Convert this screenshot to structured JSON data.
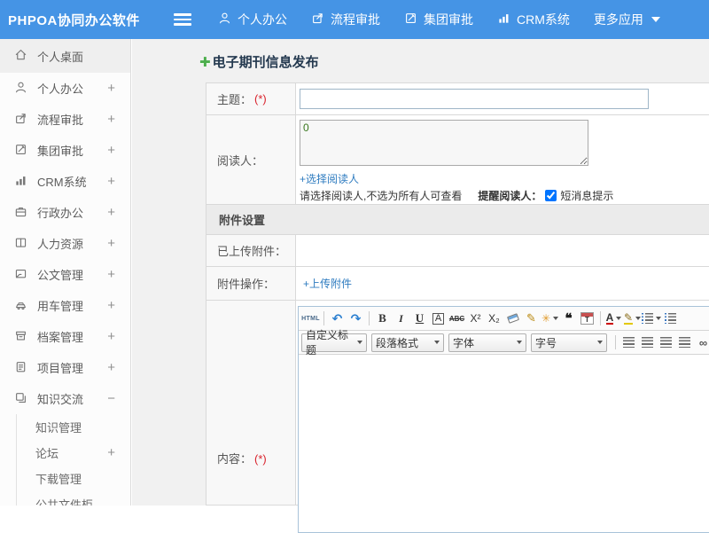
{
  "header": {
    "brand": "PHPOA协同办公软件",
    "nav": [
      {
        "label": "个人办公"
      },
      {
        "label": "流程审批"
      },
      {
        "label": "集团审批"
      },
      {
        "label": "CRM系统"
      },
      {
        "label": "更多应用"
      }
    ]
  },
  "sidebar": {
    "items": [
      {
        "label": "个人桌面",
        "expand": ""
      },
      {
        "label": "个人办公",
        "expand": "+"
      },
      {
        "label": "流程审批",
        "expand": "+"
      },
      {
        "label": "集团审批",
        "expand": "+"
      },
      {
        "label": "CRM系统",
        "expand": "+"
      },
      {
        "label": "行政办公",
        "expand": "+"
      },
      {
        "label": "人力资源",
        "expand": "+"
      },
      {
        "label": "公文管理",
        "expand": "+"
      },
      {
        "label": "用车管理",
        "expand": "+"
      },
      {
        "label": "档案管理",
        "expand": "+"
      },
      {
        "label": "项目管理",
        "expand": "+"
      },
      {
        "label": "知识交流",
        "expand": "−"
      }
    ],
    "subitems": [
      {
        "label": "知识管理",
        "expand": ""
      },
      {
        "label": "论坛",
        "expand": "+"
      },
      {
        "label": "下载管理",
        "expand": ""
      },
      {
        "label": "公共文件柜",
        "expand": ""
      }
    ]
  },
  "main": {
    "page_title": "电子期刊信息发布",
    "form": {
      "subject_label": "主题：",
      "required_mark": "(*)",
      "readers_label": "阅读人：",
      "readers_value": "0",
      "choose_readers_link": "+选择阅读人",
      "readers_hint": "请选择阅读人,不选为所有人可查看",
      "remind_label": "提醒阅读人：",
      "sms_label": "短消息提示",
      "attach_section_title": "附件设置",
      "uploaded_label": "已上传附件：",
      "attach_ops_label": "附件操作：",
      "upload_link": "+上传附件",
      "content_label": "内容："
    },
    "editor": {
      "icons": {
        "html": "HTML",
        "undo": "↶",
        "redo": "↷",
        "bold": "B",
        "italic": "I",
        "underline": "U",
        "fontborder": "A",
        "strike": "ABC",
        "sup": "X²",
        "sub": "X₂",
        "brush": "✎",
        "wand": "✳",
        "quote": "❝",
        "date_letter": "T",
        "forecolor": "A",
        "highlight": "✎",
        "link": "∞",
        "unlink": "∞",
        "unlink_x": "×"
      },
      "selects": [
        {
          "label": "自定义标题"
        },
        {
          "label": "段落格式"
        },
        {
          "label": "字体"
        },
        {
          "label": "字号"
        }
      ]
    }
  },
  "colors": {
    "header_bg": "#4594e5",
    "link": "#2f7cc0",
    "required": "#d9232d",
    "plus_icon_green": "#4cae4c",
    "section_bg": "#ebebeb",
    "readers_value_green": "#38761d"
  }
}
